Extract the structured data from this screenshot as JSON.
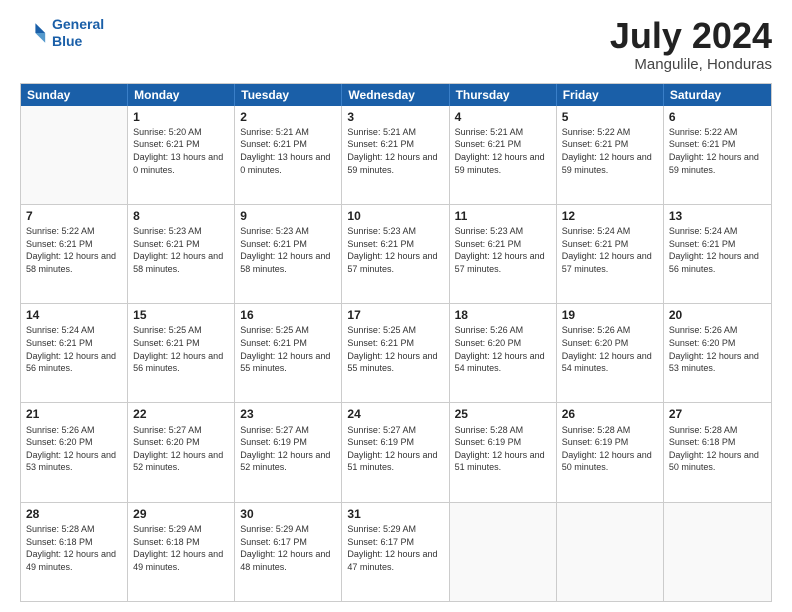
{
  "header": {
    "logo_line1": "General",
    "logo_line2": "Blue",
    "main_title": "July 2024",
    "subtitle": "Mangulile, Honduras"
  },
  "calendar": {
    "days": [
      "Sunday",
      "Monday",
      "Tuesday",
      "Wednesday",
      "Thursday",
      "Friday",
      "Saturday"
    ],
    "rows": [
      [
        {
          "day": "",
          "sunrise": "",
          "sunset": "",
          "daylight": ""
        },
        {
          "day": "1",
          "sunrise": "5:20 AM",
          "sunset": "6:21 PM",
          "daylight": "13 hours and 0 minutes."
        },
        {
          "day": "2",
          "sunrise": "5:21 AM",
          "sunset": "6:21 PM",
          "daylight": "13 hours and 0 minutes."
        },
        {
          "day": "3",
          "sunrise": "5:21 AM",
          "sunset": "6:21 PM",
          "daylight": "12 hours and 59 minutes."
        },
        {
          "day": "4",
          "sunrise": "5:21 AM",
          "sunset": "6:21 PM",
          "daylight": "12 hours and 59 minutes."
        },
        {
          "day": "5",
          "sunrise": "5:22 AM",
          "sunset": "6:21 PM",
          "daylight": "12 hours and 59 minutes."
        },
        {
          "day": "6",
          "sunrise": "5:22 AM",
          "sunset": "6:21 PM",
          "daylight": "12 hours and 59 minutes."
        }
      ],
      [
        {
          "day": "7",
          "sunrise": "5:22 AM",
          "sunset": "6:21 PM",
          "daylight": "12 hours and 58 minutes."
        },
        {
          "day": "8",
          "sunrise": "5:23 AM",
          "sunset": "6:21 PM",
          "daylight": "12 hours and 58 minutes."
        },
        {
          "day": "9",
          "sunrise": "5:23 AM",
          "sunset": "6:21 PM",
          "daylight": "12 hours and 58 minutes."
        },
        {
          "day": "10",
          "sunrise": "5:23 AM",
          "sunset": "6:21 PM",
          "daylight": "12 hours and 57 minutes."
        },
        {
          "day": "11",
          "sunrise": "5:23 AM",
          "sunset": "6:21 PM",
          "daylight": "12 hours and 57 minutes."
        },
        {
          "day": "12",
          "sunrise": "5:24 AM",
          "sunset": "6:21 PM",
          "daylight": "12 hours and 57 minutes."
        },
        {
          "day": "13",
          "sunrise": "5:24 AM",
          "sunset": "6:21 PM",
          "daylight": "12 hours and 56 minutes."
        }
      ],
      [
        {
          "day": "14",
          "sunrise": "5:24 AM",
          "sunset": "6:21 PM",
          "daylight": "12 hours and 56 minutes."
        },
        {
          "day": "15",
          "sunrise": "5:25 AM",
          "sunset": "6:21 PM",
          "daylight": "12 hours and 56 minutes."
        },
        {
          "day": "16",
          "sunrise": "5:25 AM",
          "sunset": "6:21 PM",
          "daylight": "12 hours and 55 minutes."
        },
        {
          "day": "17",
          "sunrise": "5:25 AM",
          "sunset": "6:21 PM",
          "daylight": "12 hours and 55 minutes."
        },
        {
          "day": "18",
          "sunrise": "5:26 AM",
          "sunset": "6:20 PM",
          "daylight": "12 hours and 54 minutes."
        },
        {
          "day": "19",
          "sunrise": "5:26 AM",
          "sunset": "6:20 PM",
          "daylight": "12 hours and 54 minutes."
        },
        {
          "day": "20",
          "sunrise": "5:26 AM",
          "sunset": "6:20 PM",
          "daylight": "12 hours and 53 minutes."
        }
      ],
      [
        {
          "day": "21",
          "sunrise": "5:26 AM",
          "sunset": "6:20 PM",
          "daylight": "12 hours and 53 minutes."
        },
        {
          "day": "22",
          "sunrise": "5:27 AM",
          "sunset": "6:20 PM",
          "daylight": "12 hours and 52 minutes."
        },
        {
          "day": "23",
          "sunrise": "5:27 AM",
          "sunset": "6:19 PM",
          "daylight": "12 hours and 52 minutes."
        },
        {
          "day": "24",
          "sunrise": "5:27 AM",
          "sunset": "6:19 PM",
          "daylight": "12 hours and 51 minutes."
        },
        {
          "day": "25",
          "sunrise": "5:28 AM",
          "sunset": "6:19 PM",
          "daylight": "12 hours and 51 minutes."
        },
        {
          "day": "26",
          "sunrise": "5:28 AM",
          "sunset": "6:19 PM",
          "daylight": "12 hours and 50 minutes."
        },
        {
          "day": "27",
          "sunrise": "5:28 AM",
          "sunset": "6:18 PM",
          "daylight": "12 hours and 50 minutes."
        }
      ],
      [
        {
          "day": "28",
          "sunrise": "5:28 AM",
          "sunset": "6:18 PM",
          "daylight": "12 hours and 49 minutes."
        },
        {
          "day": "29",
          "sunrise": "5:29 AM",
          "sunset": "6:18 PM",
          "daylight": "12 hours and 49 minutes."
        },
        {
          "day": "30",
          "sunrise": "5:29 AM",
          "sunset": "6:17 PM",
          "daylight": "12 hours and 48 minutes."
        },
        {
          "day": "31",
          "sunrise": "5:29 AM",
          "sunset": "6:17 PM",
          "daylight": "12 hours and 47 minutes."
        },
        {
          "day": "",
          "sunrise": "",
          "sunset": "",
          "daylight": ""
        },
        {
          "day": "",
          "sunrise": "",
          "sunset": "",
          "daylight": ""
        },
        {
          "day": "",
          "sunrise": "",
          "sunset": "",
          "daylight": ""
        }
      ]
    ]
  }
}
